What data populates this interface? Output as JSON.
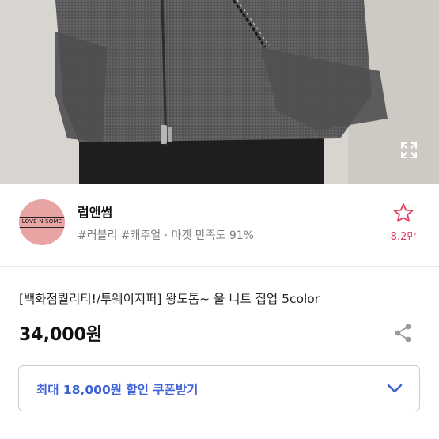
{
  "seller": {
    "logo_text": "LOVE N SOME",
    "name": "럽앤썸",
    "meta": "#러블리 #캐주얼 · 마켓 만족도 91%"
  },
  "like": {
    "icon": "star-outline-icon",
    "count": "8.2만"
  },
  "product": {
    "title": "[백화점퀄리티!/투웨이지퍼] 왕도톰~ 울 니트 집업 5color",
    "price": "34,000원"
  },
  "coupon": {
    "label": "최대 18,000원 할인 쿠폰받기",
    "icon": "chevron-down-icon"
  },
  "icons": {
    "expand": "expand-icon",
    "share": "share-icon"
  },
  "colors": {
    "accent_blue": "#3f63d6",
    "like_red": "#e23b5a",
    "logo_pink": "#e8a3a3",
    "meta_gray": "#7d7d7d"
  }
}
